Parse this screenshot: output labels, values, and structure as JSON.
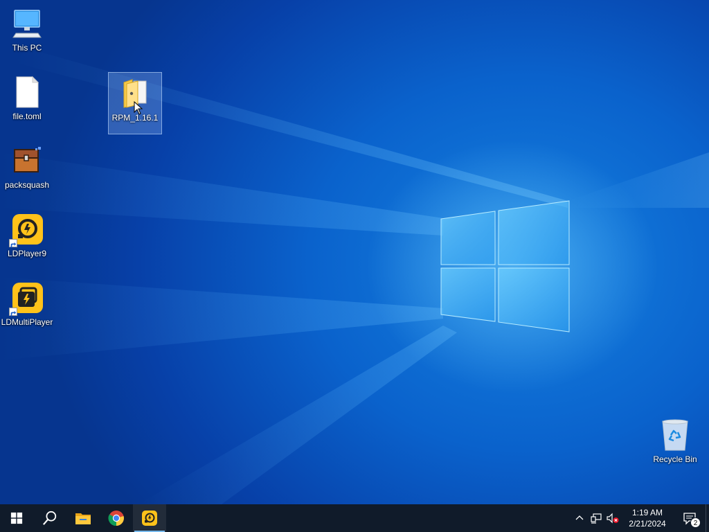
{
  "desktop": {
    "icons": [
      {
        "label": "This PC",
        "icon": "computer-icon"
      },
      {
        "label": "file.toml",
        "icon": "blank-file-icon"
      },
      {
        "label": "RPM_1.16.1",
        "icon": "zip-folder-icon",
        "selected": true
      },
      {
        "label": "packsquash",
        "icon": "treasure-chest-icon"
      },
      {
        "label": "LDPlayer9",
        "icon": "ldplayer-icon",
        "shortcut": true
      },
      {
        "label": "LDMultiPlayer",
        "icon": "ldmultiplayer-icon",
        "shortcut": true
      },
      {
        "label": "Recycle Bin",
        "icon": "recycle-bin-icon"
      }
    ],
    "accent_color": "#0a5fc9"
  },
  "taskbar": {
    "buttons": [
      {
        "icon": "windows-start-icon"
      },
      {
        "icon": "search-icon"
      },
      {
        "icon": "file-explorer-icon"
      },
      {
        "icon": "chrome-icon"
      },
      {
        "icon": "ldplayer-taskbar-icon",
        "active": true
      }
    ],
    "tray": {
      "icons": [
        "chevron-up-icon",
        "network-icon",
        "volume-muted-icon"
      ],
      "time": "1:19 AM",
      "date": "2/21/2024",
      "notification_count": "2"
    },
    "background_color": "#101b2a"
  }
}
